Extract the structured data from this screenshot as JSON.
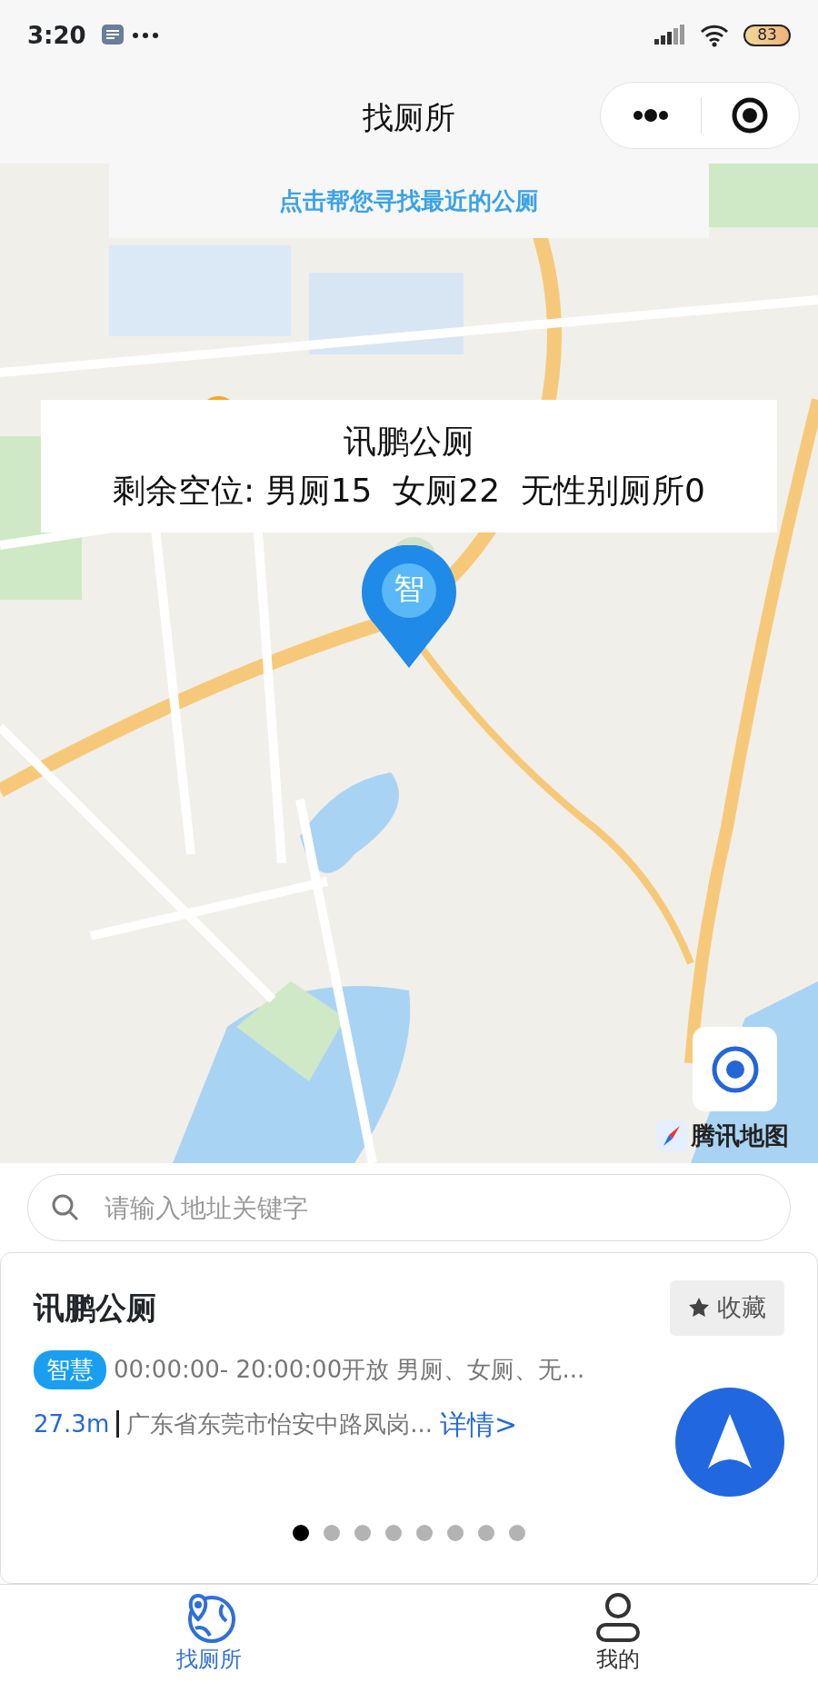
{
  "status_bar": {
    "time": "3:20",
    "battery": "83"
  },
  "nav_bar": {
    "title": "找厕所"
  },
  "map": {
    "banner": "点击帮您寻找最近的公厕",
    "popup": {
      "title": "讯鹏公厕",
      "availability": "剩余空位: 男厕15  女厕22  无性别厕所0"
    },
    "marker": "智",
    "logo": "腾讯地图"
  },
  "search": {
    "placeholder": "请输入地址关键字"
  },
  "card": {
    "title": "讯鹏公厕",
    "favorite": "收藏",
    "tag": "智慧",
    "hours": "00:00:00- 20:00:00开放  男厕、女厕、无...",
    "distance": "27.3m",
    "address": "广东省东莞市怡安中路凤岗...",
    "details": "详情>"
  },
  "pager": [
    {
      "selected": true
    },
    {
      "selected": false
    },
    {
      "selected": false
    },
    {
      "selected": false
    },
    {
      "selected": false
    },
    {
      "selected": false
    },
    {
      "selected": false
    },
    {
      "selected": false
    }
  ],
  "tab_bar": [
    {
      "label": "找厕所",
      "kind": "map",
      "selected": true
    },
    {
      "label": "我的",
      "kind": "profile",
      "selected": false
    }
  ]
}
